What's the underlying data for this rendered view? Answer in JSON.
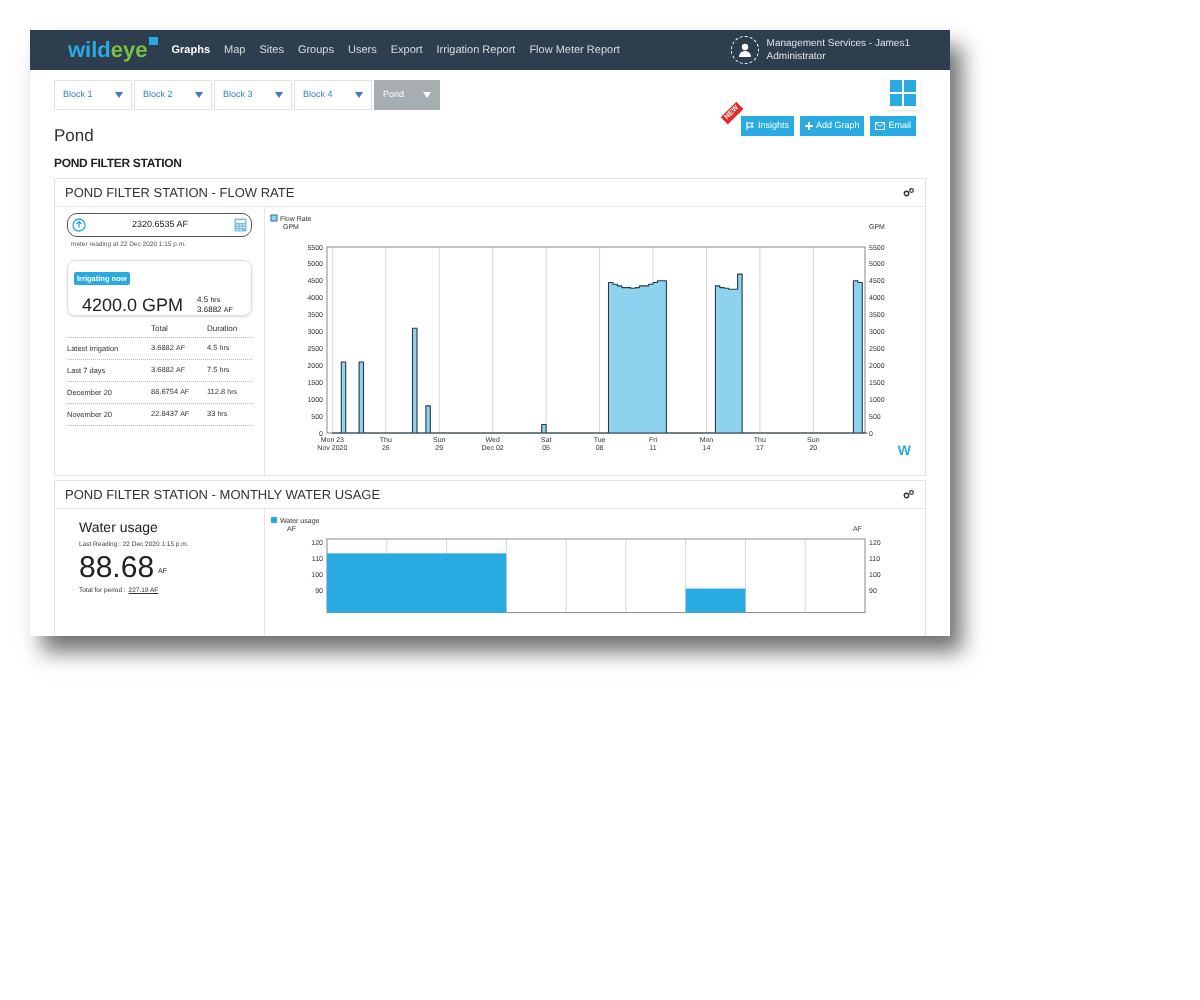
{
  "header": {
    "logo": {
      "part_1": "wild",
      "part_2": "eye"
    },
    "nav": [
      {
        "label": "Graphs",
        "selected": true
      },
      {
        "label": "Map",
        "selected": false
      },
      {
        "label": "Sites",
        "selected": false
      },
      {
        "label": "Groups",
        "selected": false
      },
      {
        "label": "Users",
        "selected": false
      },
      {
        "label": "Export",
        "selected": false
      },
      {
        "label": "Irrigation Report",
        "selected": false
      },
      {
        "label": "Flow Meter Report",
        "selected": false
      }
    ],
    "user": {
      "name": "Management Services - James1",
      "role": "Administrator"
    }
  },
  "site_tabs": [
    {
      "label": "Block 1",
      "selected": false
    },
    {
      "label": "Block 2",
      "selected": false
    },
    {
      "label": "Block 3",
      "selected": false
    },
    {
      "label": "Block 4",
      "selected": false
    },
    {
      "label": "Pond",
      "selected": true
    }
  ],
  "page_title": "Pond",
  "actions": [
    {
      "label": "Insights",
      "kind": "insights",
      "badge": "NEW"
    },
    {
      "label": "Add Graph",
      "kind": "add"
    },
    {
      "label": "Email",
      "kind": "email"
    }
  ],
  "section_title": "POND FILTER STATION",
  "flow_panel": {
    "title": "POND FILTER STATION - FLOW RATE",
    "meter": {
      "reading": "2320.6535 AF",
      "caption": "meter reading at 22 Dec 2020 1:15 p.m."
    },
    "status": {
      "badge": "Irrigating now",
      "rate": "4200.0 GPM",
      "duration": "4.5",
      "duration_unit": "hrs",
      "volume": "3.6882",
      "volume_unit": "AF"
    },
    "summary": {
      "columns": [
        "Total",
        "Duration"
      ],
      "rows": [
        {
          "label": "Latest irrigation",
          "total": "3.6882",
          "total_unit": "AF",
          "duration": "4.5",
          "duration_unit": "hrs"
        },
        {
          "label": "Last 7 days",
          "total": "3.6882",
          "total_unit": "AF",
          "duration": "7.5",
          "duration_unit": "hrs"
        },
        {
          "label": "December 20",
          "total": "88.6754",
          "total_unit": "AF",
          "duration": "112.8",
          "duration_unit": "hrs"
        },
        {
          "label": "November 20",
          "total": "22.8437",
          "total_unit": "AF",
          "duration": "33",
          "duration_unit": "hrs"
        }
      ]
    },
    "chart_logo": "W",
    "chart_data": {
      "type": "area",
      "ylabel": "GPM",
      "y2label": "GPM",
      "ylim": [
        0,
        5500
      ],
      "y2lim": [
        0,
        5500
      ],
      "yticks": [
        0,
        500,
        1000,
        1500,
        2000,
        2500,
        3000,
        3500,
        4000,
        4500,
        5000,
        5500
      ],
      "y2ticks": [
        0,
        500,
        1000,
        1500,
        2000,
        2500,
        3000,
        3500,
        4000,
        4500,
        5000,
        5500
      ],
      "categories": [
        "Mon 23\nNov 2020",
        null,
        null,
        null,
        null,
        null,
        null,
        null,
        null,
        null,
        null,
        null,
        "Thu\n26",
        null,
        null,
        null,
        null,
        null,
        null,
        null,
        null,
        null,
        null,
        null,
        "Sun\n29",
        null,
        null,
        null,
        null,
        null,
        null,
        null,
        null,
        null,
        null,
        null,
        "Wed\nDec 02",
        null,
        null,
        null,
        null,
        null,
        null,
        null,
        null,
        null,
        null,
        null,
        "Sat\n05",
        null,
        null,
        null,
        null,
        null,
        null,
        null,
        null,
        null,
        null,
        null,
        "Tue\n08",
        null,
        null,
        null,
        null,
        null,
        null,
        null,
        null,
        null,
        null,
        null,
        "Fri\n11",
        null,
        null,
        null,
        null,
        null,
        null,
        null,
        null,
        null,
        null,
        null,
        "Mon\n14",
        null,
        null,
        null,
        null,
        null,
        null,
        null,
        null,
        null,
        null,
        null,
        "Thu\n17",
        null,
        null,
        null,
        null,
        null,
        null,
        null,
        null,
        null,
        null,
        null,
        "Sun\n20",
        null,
        null,
        null,
        null,
        null,
        null,
        null,
        null,
        null,
        null,
        null
      ],
      "series": [
        {
          "name": "Flow Rate",
          "color": "#8dd3f0",
          "values": [
            0,
            0,
            2100,
            0,
            0,
            0,
            2100,
            0,
            0,
            0,
            0,
            0,
            0,
            0,
            0,
            0,
            0,
            0,
            3100,
            0,
            0,
            800,
            0,
            0,
            0,
            0,
            0,
            0,
            0,
            0,
            0,
            0,
            0,
            0,
            0,
            0,
            0,
            0,
            0,
            0,
            0,
            0,
            0,
            0,
            0,
            0,
            0,
            250,
            0,
            0,
            0,
            0,
            0,
            0,
            0,
            0,
            0,
            0,
            0,
            0,
            0,
            0,
            4450,
            4400,
            4350,
            4300,
            4300,
            4280,
            4300,
            4350,
            4350,
            4400,
            4450,
            4500,
            4500,
            0,
            0,
            0,
            0,
            0,
            0,
            0,
            0,
            0,
            0,
            0,
            4350,
            4300,
            4280,
            4250,
            4250,
            4700,
            0,
            0,
            0,
            0,
            0,
            0,
            0,
            0,
            0,
            0,
            0,
            0,
            0,
            0,
            0,
            0,
            0,
            0,
            0,
            0,
            0,
            0,
            0,
            0,
            0,
            4500,
            4450,
            0
          ]
        }
      ]
    }
  },
  "usage_panel": {
    "title": "POND FILTER STATION - MONTHLY WATER USAGE",
    "heading": "Water usage",
    "last_reading": "Last Reading : 22 Dec 2020 1:15 p.m.",
    "value": "88.68",
    "unit": "AF",
    "total_label": "Total for period :",
    "total_value": "227.18 AF",
    "chart": {
      "legend": "Water usage",
      "left_unit": "AF",
      "right_unit": "AF",
      "left_ticks": [
        "120",
        "110",
        "100",
        "90"
      ],
      "right_ticks": [
        "120",
        "110",
        "100",
        "90"
      ]
    }
  }
}
